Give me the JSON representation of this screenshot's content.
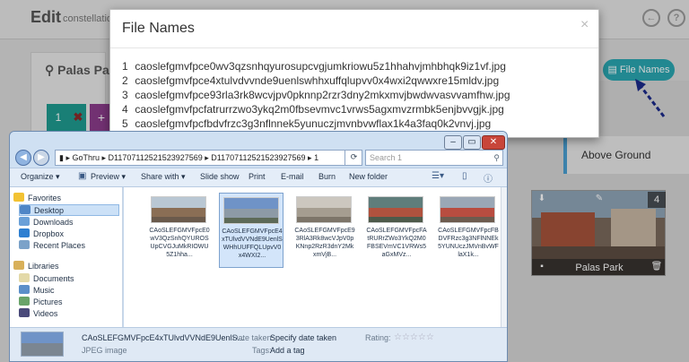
{
  "app": {
    "title": "Edit",
    "subtitle": "constellation",
    "location_title": "Palas Parks",
    "tile_number": "1",
    "file_names_button": "File Names",
    "above_ground": "Above Ground",
    "pano": {
      "label": "Palas Park",
      "number": "4"
    }
  },
  "modal": {
    "title": "File Names",
    "close": "×",
    "files": [
      {
        "n": "1",
        "name": "caoslefgmvfpce0wv3qzsnhqyurosupcvgjumkriowu5z1hhahvjmhbhqk9iz1vf.jpg"
      },
      {
        "n": "2",
        "name": "caoslefgmvfpce4xtulvdvvnde9uenlswhhxuffqlupvv0x4wxi2qwwxre15mldv.jpg"
      },
      {
        "n": "3",
        "name": "caoslefgmvfpce93rla3rk8wcvjpv0pknnp2rzr3dny2mkxmvjbwdwvasvvamfhw.jpg"
      },
      {
        "n": "4",
        "name": "caoslefgmvfpcfatrurrzwo3ykq2m0fbsevmvc1vrws5agxmvzrmbk5enjbvvgjk.jpg"
      },
      {
        "n": "5",
        "name": "caoslefgmvfpcfbdvfrzc3g3nflnnek5yunuczjmvnbvwflax1k4a3faq0k2vnvj.jpg"
      }
    ]
  },
  "explorer": {
    "address": "▸ GoThru ▸ D1170711252152392​7569 ▸ D11707112521523927569 ▸ 1",
    "search_placeholder": "Search 1",
    "toolbar": {
      "organize": "Organize ▾",
      "preview": "Preview ▾",
      "share": "Share with ▾",
      "slideshow": "Slide show",
      "print": "Print",
      "email": "E-mail",
      "burn": "Burn",
      "new_folder": "New folder"
    },
    "nav": {
      "favorites": "Favorites",
      "desktop": "Desktop",
      "downloads": "Downloads",
      "dropbox": "Dropbox",
      "recent": "Recent Places",
      "libraries": "Libraries",
      "documents": "Documents",
      "music": "Music",
      "pictures": "Pictures",
      "videos": "Videos"
    },
    "thumbs": [
      {
        "name": "CAoSLEFGMVFpcE0wV3QzSnhQYUROSUpCVGJuMkRIOWU5Z1hha..."
      },
      {
        "name": "CAoSLEFGMVFpcE4xTUlvdVVNdE9UenlSWHhUUFFQLUpvV0x4WXI2..."
      },
      {
        "name": "CAoSLEFGMVFpcE93RlA3Rk8wcVJpV0pKNnp2RzR3dnY2MkxmVjB..."
      },
      {
        "name": "CAoSLEFGMVFpcFAtRURrZWo3YkQ2M0FBSEVmVC1VRWs5aGxMVz..."
      },
      {
        "name": "CAoSLEFGMVFpcFBDVFRzc3g3NFlNNEk5YUNUczJMVnBvWFlaX1k..."
      }
    ],
    "details": {
      "filename": "CAoSLEFGMVFpcE4xTUlvdVVNdE9UenlS...",
      "type": "JPEG image",
      "date_label": "Date taken:",
      "date_value": "Specify date taken",
      "tags_label": "Tags:",
      "tags_value": "Add a tag",
      "rating_label": "Rating:",
      "stars": "☆☆☆☆☆"
    }
  },
  "colors": {
    "teal": "#2aa7b1",
    "accent_blue": "#4a9fd1"
  }
}
